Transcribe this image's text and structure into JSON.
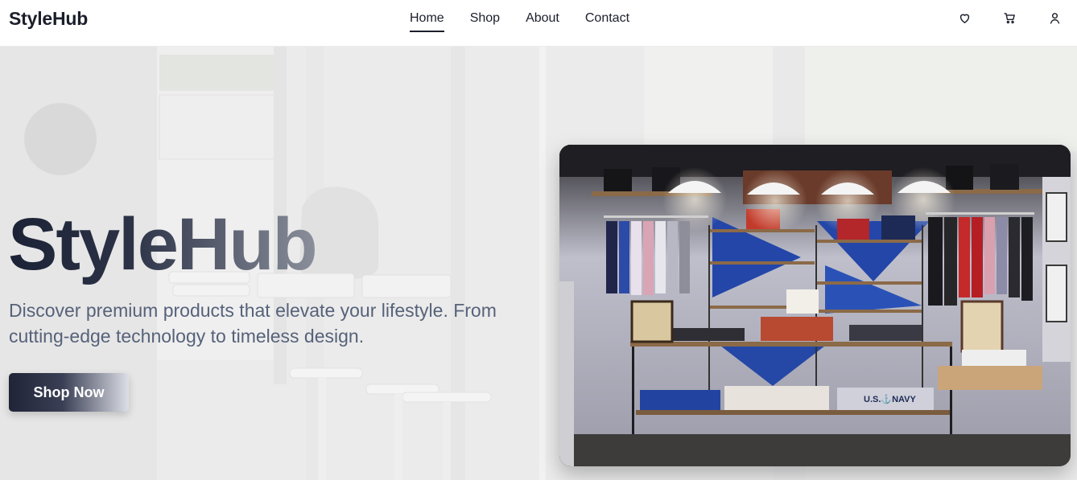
{
  "brand": {
    "name": "StyleHub"
  },
  "nav": {
    "items": [
      {
        "label": "Home",
        "active": true
      },
      {
        "label": "Shop",
        "active": false
      },
      {
        "label": "About",
        "active": false
      },
      {
        "label": "Contact",
        "active": false
      }
    ]
  },
  "header_icons": [
    "heart-icon",
    "cart-icon",
    "user-icon"
  ],
  "hero": {
    "title": "StyleHub",
    "subtitle": "Discover premium products that elevate your lifestyle. From cutting-edge technology to timeless design.",
    "cta_label": "Shop Now",
    "image_text": {
      "navy_shirt": "U.S.⚓NAVY"
    }
  },
  "colors": {
    "text_dark": "#1b1f2b",
    "subtitle": "#56627a",
    "hero_bg": "#ededed"
  }
}
